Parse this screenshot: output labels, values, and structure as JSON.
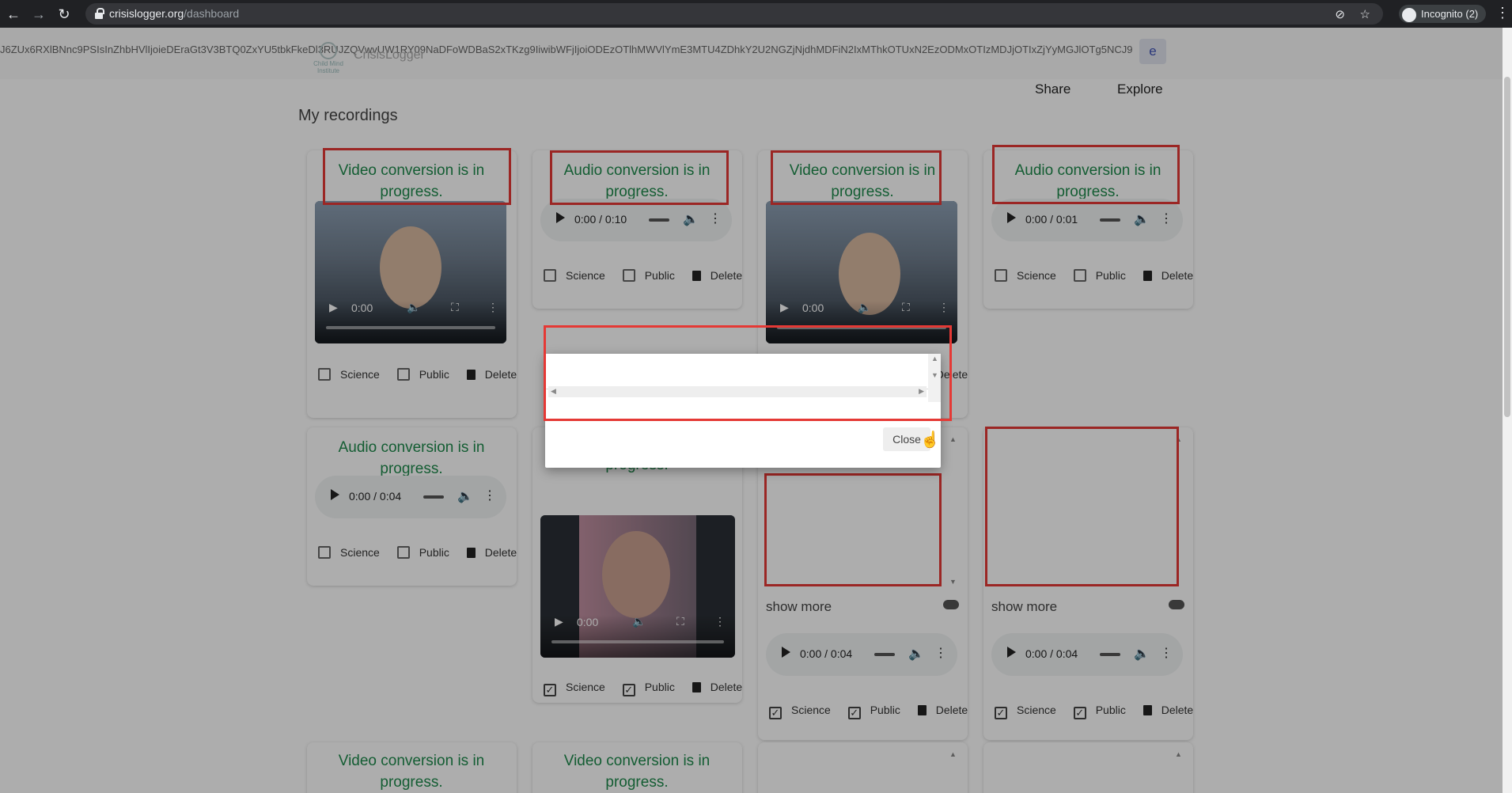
{
  "browser": {
    "url_host": "crisislogger.org",
    "url_path": "/dashboard",
    "incognito_label": "Incognito (2)"
  },
  "app": {
    "token_text": "J6ZUx6RXlBNnc9PSIsInZhbHVlIjoieDEraGt3V3BTQ0ZxYU5tbkFkeDl3RUJZQVwvUW1RY09NaDFoWDBaS2xTKzg9IiwibWFjIjoiODEzOTlhMWVlYmE3MTU4ZDhkY2U2NGZjNjdhMDFiN2IxMThkOTUxN2EzODMxOTIzMDJjOTIxZjYyMGJlOTg5NCJ9",
    "logo_caption": "Child Mind Institute",
    "brand": "CrisisLogger",
    "e_button": "e",
    "menu": [
      "Share",
      "Explore"
    ],
    "heading": "My recordings"
  },
  "labels": {
    "science": "Science",
    "public": "Public",
    "delete": "Delete",
    "show_more": "show more",
    "video_time": "0:00",
    "close": "Close"
  },
  "cards": [
    {
      "status": "Video conversion is in progress.",
      "type": "video",
      "science": false,
      "public": false
    },
    {
      "status": "Audio conversion is in progress.",
      "type": "audio",
      "time": "0:00 / 0:10",
      "science": false,
      "public": false
    },
    {
      "status": "Video conversion is in progress.",
      "type": "video",
      "science": false,
      "public": false
    },
    {
      "status": "Audio conversion is in progress.",
      "type": "audio",
      "time": "0:00 / 0:01",
      "science": false,
      "public": false
    },
    {
      "status": "Audio conversion is in progress.",
      "type": "audio",
      "time": "0:00 / 0:04",
      "science": false,
      "public": false
    },
    {
      "status": "progress.",
      "type": "video",
      "science": true,
      "public": true
    },
    {
      "status": "",
      "type": "text-audio",
      "time": "0:00 / 0:04",
      "science": true,
      "public": true
    },
    {
      "status": "",
      "type": "text-audio",
      "time": "0:00 / 0:04",
      "science": true,
      "public": true
    },
    {
      "status": "Video conversion is in progress.",
      "type": "video"
    },
    {
      "status": "Video conversion is in progress.",
      "type": "video"
    }
  ],
  "colors": {
    "status_green": "#1e8a4c",
    "highlight_red": "#e53935",
    "overlay": "rgba(0,0,0,0.32)"
  }
}
